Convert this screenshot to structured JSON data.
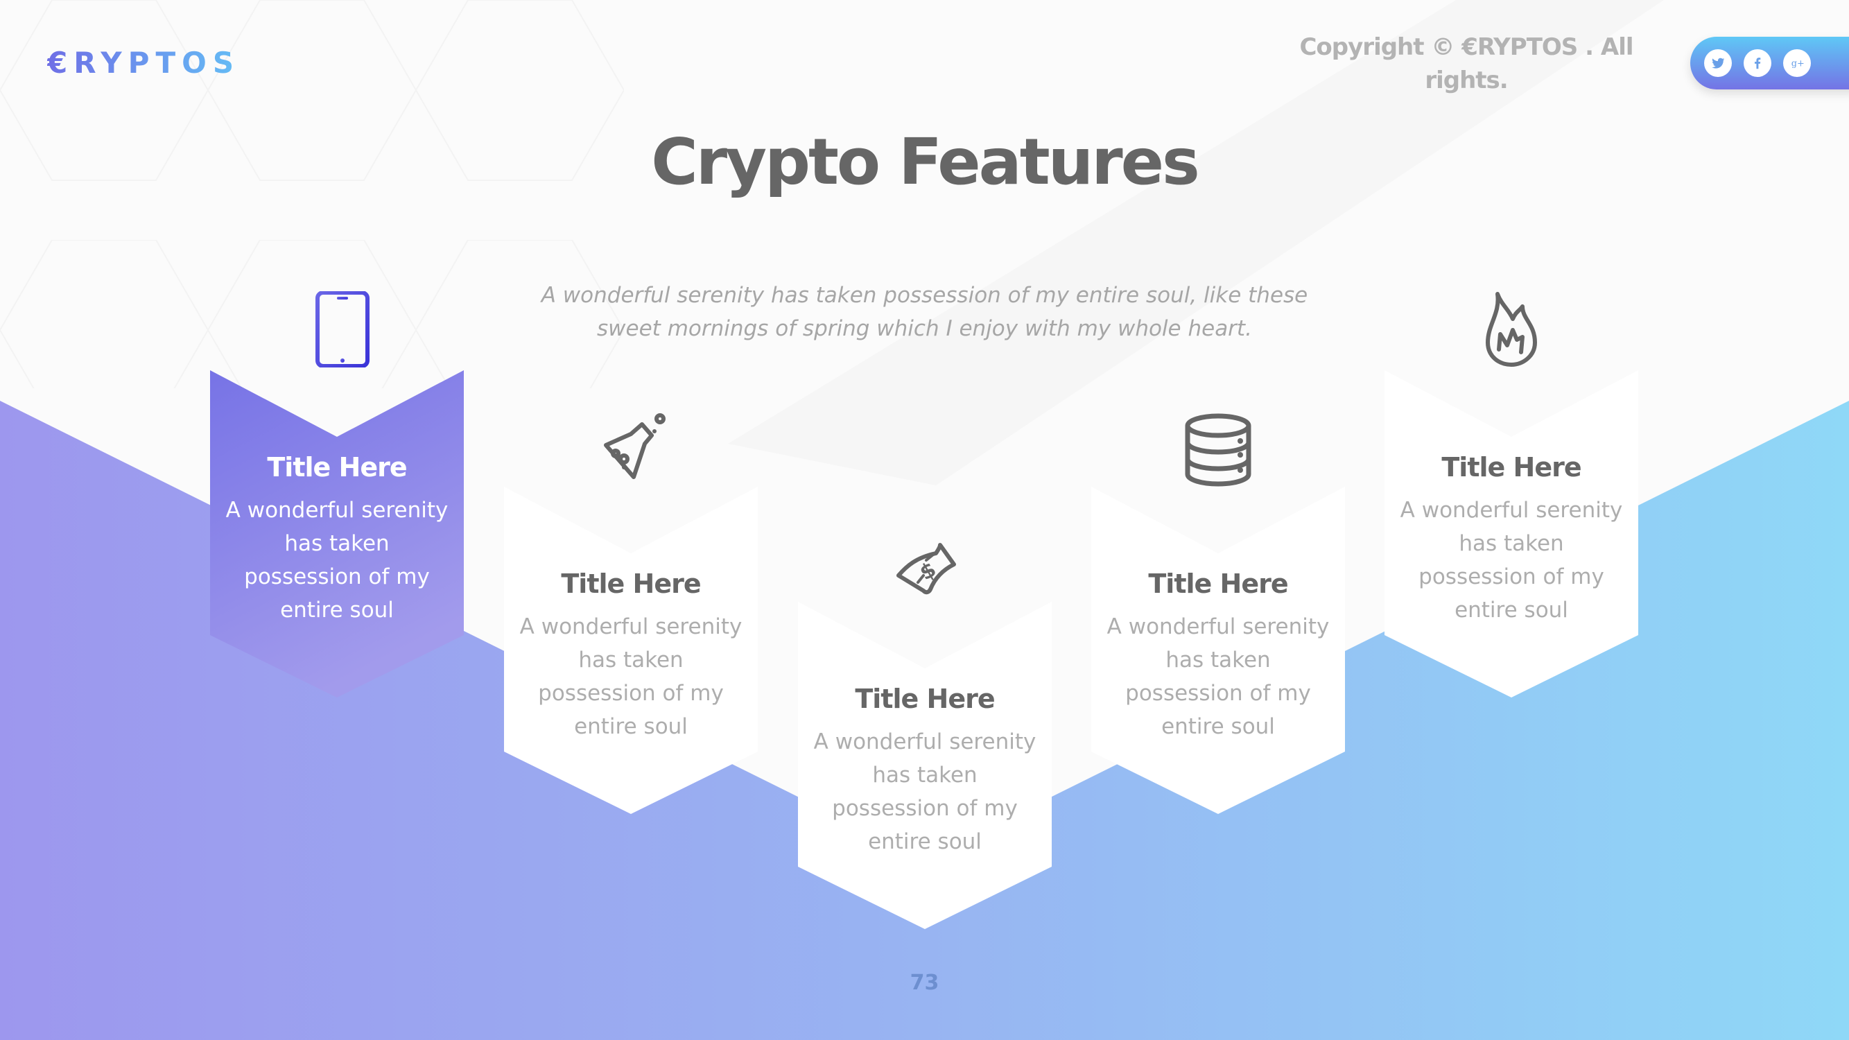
{
  "brand": {
    "logo_text": "€RYPTOS"
  },
  "header": {
    "copyright": "Copyright © €RYPTOS . All rights.",
    "social": [
      {
        "name": "twitter",
        "icon": "twitter-icon"
      },
      {
        "name": "facebook",
        "icon": "facebook-icon",
        "glyph": "f"
      },
      {
        "name": "google-plus",
        "icon": "google-plus-icon",
        "glyph": "g+"
      }
    ]
  },
  "main": {
    "title": "Crypto Features",
    "subtitle": "A wonderful serenity has taken possession of my entire soul, like these sweet mornings of spring which I enjoy with my whole heart.",
    "cards": [
      {
        "icon": "tablet-icon",
        "title": "Title Here",
        "description": "A wonderful serenity has taken possession of my entire soul",
        "active": true
      },
      {
        "icon": "flask-icon",
        "title": "Title Here",
        "description": "A wonderful serenity has taken possession of my entire soul",
        "active": false
      },
      {
        "icon": "money-bill-icon",
        "title": "Title Here",
        "description": "A wonderful serenity has taken possession of my entire soul",
        "active": false
      },
      {
        "icon": "database-icon",
        "title": "Title Here",
        "description": "A wonderful serenity has taken possession of my entire soul",
        "active": false
      },
      {
        "icon": "fire-icon",
        "title": "Title Here",
        "description": "A wonderful serenity has taken possession of my entire soul",
        "active": false
      }
    ]
  },
  "footer": {
    "page_number": "73"
  },
  "colors": {
    "gradient_start": "#9d97ee",
    "gradient_end": "#8fd8f7",
    "active_card_top": "#7773e6",
    "active_card_bottom": "#a29bec",
    "text_dark": "#666666",
    "text_muted": "#adadad"
  }
}
